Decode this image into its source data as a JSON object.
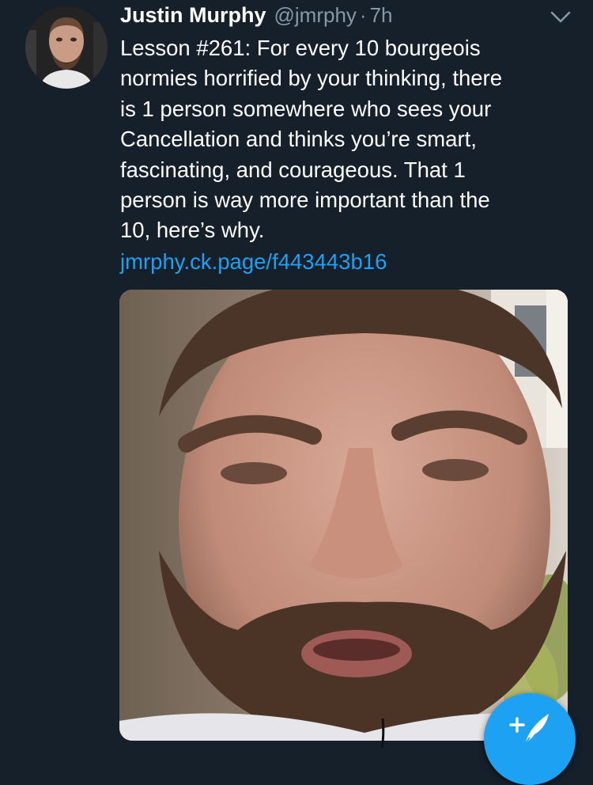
{
  "tweet": {
    "author_name": "Justin Murphy",
    "author_handle": "@jmrphy",
    "separator": "·",
    "timestamp": "7h",
    "text_lines": [
      "Lesson #261: For every 10 bourgeois",
      "normies horrified by your thinking, there",
      "is 1 person somewhere who sees your",
      "Cancellation and thinks you’re smart,",
      "fascinating, and courageous. That 1",
      "person is way more important than the",
      "10, here’s why."
    ],
    "link": "jmrphy.ck.page/f443443b16"
  },
  "icons": {
    "avatar": "avatar",
    "menu": "chevron-down-icon",
    "compose": "compose-tweet-icon",
    "media": "video-thumbnail"
  },
  "colors": {
    "background": "#15202b",
    "text": "#ffffff",
    "secondary_text": "#8899a6",
    "link": "#1da1f2",
    "accent": "#1da1f2"
  }
}
